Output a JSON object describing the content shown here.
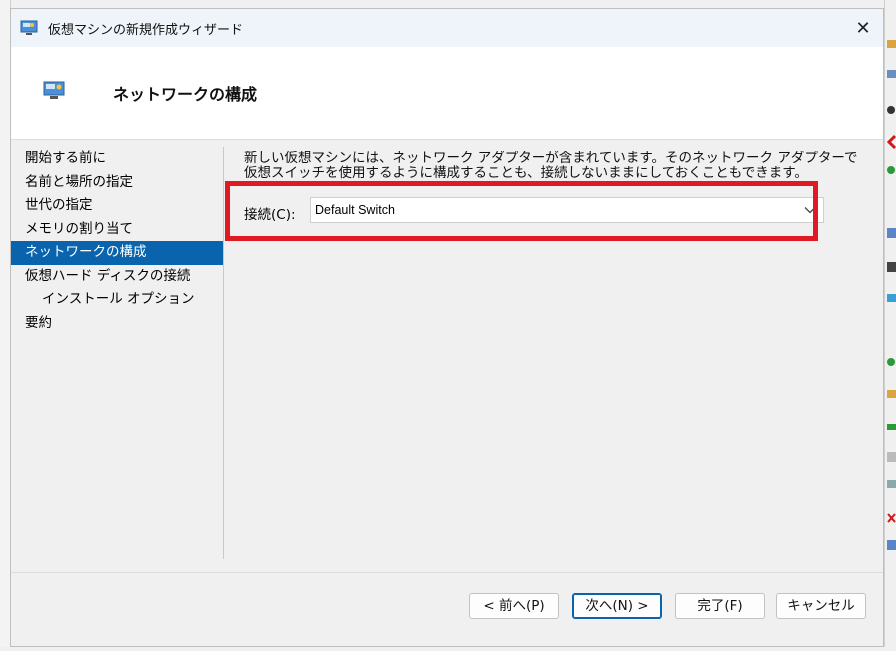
{
  "window": {
    "title": "仮想マシンの新規作成ウィザード",
    "close_glyph": "✕"
  },
  "header": {
    "title": "ネットワークの構成"
  },
  "nav": {
    "items": [
      {
        "label": "開始する前に"
      },
      {
        "label": "名前と場所の指定"
      },
      {
        "label": "世代の指定"
      },
      {
        "label": "メモリの割り当て"
      },
      {
        "label": "ネットワークの構成"
      },
      {
        "label": "仮想ハード ディスクの接続"
      },
      {
        "label": "インストール オプション"
      },
      {
        "label": "要約"
      }
    ],
    "active_index": 4
  },
  "content": {
    "description": "新しい仮想マシンには、ネットワーク アダプターが含まれています。そのネットワーク アダプターで仮想スイッチを使用するように構成することも、接続しないままにしておくこともできます。",
    "connection_label": "接続(C):",
    "connection_value": "Default Switch"
  },
  "footer": {
    "prev_label": "< 前へ(P)",
    "next_label": "次へ(N) >",
    "finish_label": "完了(F)",
    "cancel_label": "キャンセル"
  },
  "colors": {
    "accent": "#0a64ad",
    "highlight": "#e01a22"
  }
}
